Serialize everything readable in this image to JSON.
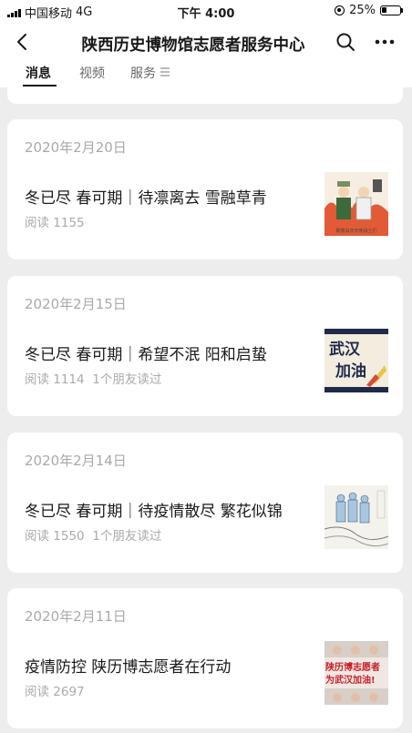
{
  "status": {
    "carrier": "中国移动",
    "network": "4G",
    "time": "下午 4:00",
    "battery": "25%",
    "battery_level": 0.25
  },
  "nav": {
    "title": "陕西历史博物馆志愿者服务中心"
  },
  "tabs": [
    {
      "label": "消息",
      "active": true
    },
    {
      "label": "视频",
      "active": false
    },
    {
      "label": "服务",
      "active": false
    }
  ],
  "articles": [
    {
      "date": "2020年2月20日",
      "title": "冬已尽 春可期｜待凛离去 雪融草青",
      "reads": "阅读 1155",
      "friends": "",
      "thumb_text": "致敬白衣天使战士们"
    },
    {
      "date": "2020年2月15日",
      "title": "冬已尽 春可期｜希望不泯 阳和启蛰",
      "reads": "阅读 1114",
      "friends": "1个朋友读过",
      "thumb_text": "武汉加油"
    },
    {
      "date": "2020年2月14日",
      "title": "冬已尽 春可期｜待疫情散尽 繁花似锦",
      "reads": "阅读 1550",
      "friends": "1个朋友读过",
      "thumb_text": ""
    },
    {
      "date": "2020年2月11日",
      "title": "疫情防控 陕历博志愿者在行动",
      "reads": "阅读 2697",
      "friends": "",
      "thumb_text": "陕历博志愿者为武汉加油!"
    }
  ],
  "colors": {
    "background": "#ededed",
    "card": "#ffffff",
    "muted_text": "#aaaaaa"
  },
  "icons": [
    "back-arrow-icon",
    "search-icon",
    "more-dots-icon",
    "tab-menu-icon"
  ]
}
